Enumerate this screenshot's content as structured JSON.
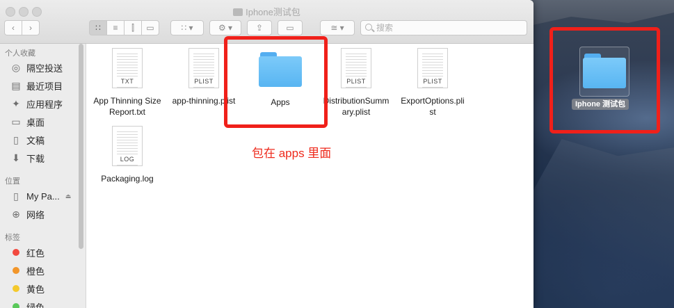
{
  "window": {
    "title": "Iphone测试包",
    "search_placeholder": "搜索"
  },
  "sidebar": {
    "favorites_header": "个人收藏",
    "favorites": [
      {
        "label": "隔空投送",
        "icon": "airdrop-icon"
      },
      {
        "label": "最近项目",
        "icon": "recents-icon"
      },
      {
        "label": "应用程序",
        "icon": "applications-icon"
      },
      {
        "label": "桌面",
        "icon": "desktop-icon"
      },
      {
        "label": "文稿",
        "icon": "documents-icon"
      },
      {
        "label": "下载",
        "icon": "downloads-icon"
      }
    ],
    "locations_header": "位置",
    "locations": [
      {
        "label": "My Pa...",
        "icon": "disk-icon"
      },
      {
        "label": "网络",
        "icon": "network-icon"
      }
    ],
    "tags_header": "标签",
    "tags": [
      {
        "label": "红色",
        "color": "#f2493f"
      },
      {
        "label": "橙色",
        "color": "#f2962a"
      },
      {
        "label": "黄色",
        "color": "#f4c92c"
      },
      {
        "label": "绿色",
        "color": "#5ac85a"
      }
    ]
  },
  "files": [
    {
      "name_line1": "App Thinning Size",
      "name_line2": "Report.txt",
      "type": "TXT"
    },
    {
      "name_line1": "app-thinning.plist",
      "name_line2": "",
      "type": "PLIST"
    },
    {
      "name_line1": "Apps",
      "name_line2": "",
      "type": "folder"
    },
    {
      "name_line1": "DistributionSumm",
      "name_line2": "ary.plist",
      "type": "PLIST"
    },
    {
      "name_line1": "ExportOptions.pli",
      "name_line2": "st",
      "type": "PLIST"
    },
    {
      "name_line1": "Packaging.log",
      "name_line2": "",
      "type": "LOG"
    }
  ],
  "annotation": "包在 apps 里面",
  "desktop": {
    "folder_label": "Iphone 测试包"
  }
}
